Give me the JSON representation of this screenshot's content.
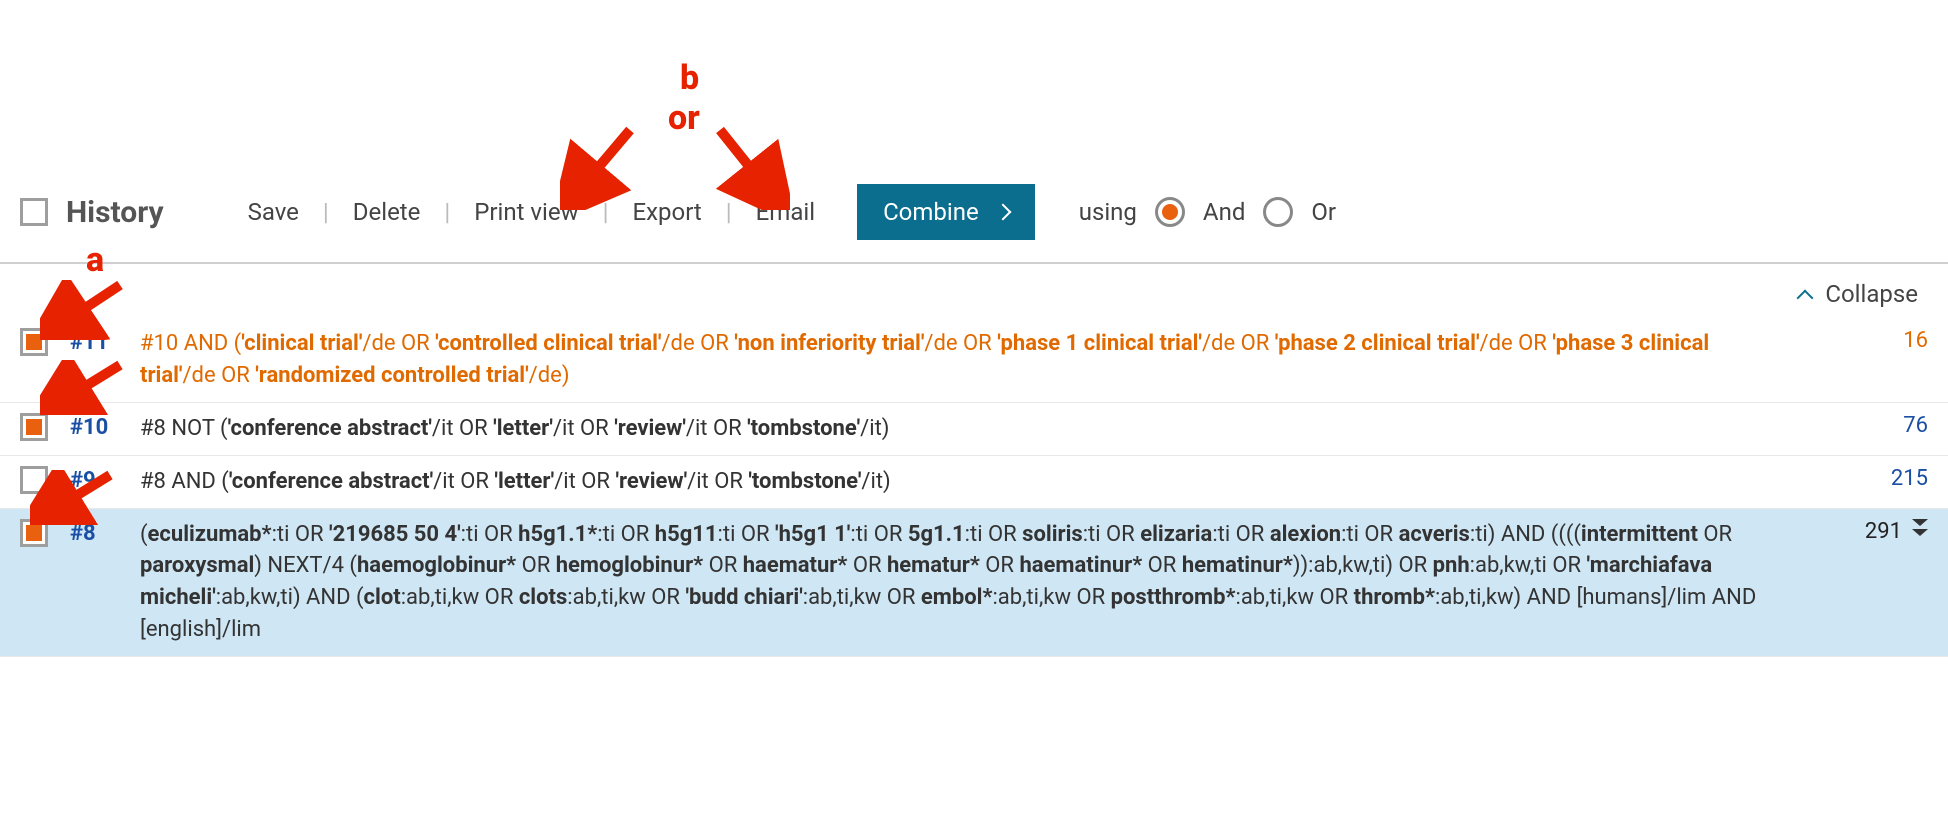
{
  "header": {
    "title": "History",
    "actions": {
      "save": "Save",
      "delete": "Delete",
      "print_view": "Print view",
      "export": "Export",
      "email": "Email"
    },
    "combine_label": "Combine",
    "using_label": "using",
    "and_label": "And",
    "or_label": "Or",
    "collapse_label": "Collapse"
  },
  "annotations": {
    "a": "a",
    "b": "b",
    "or": "or"
  },
  "rows": [
    {
      "id": "#11",
      "checked": true,
      "orange": true,
      "highlight": false,
      "count": "16",
      "count_style": "orange",
      "segments": [
        {
          "t": "#10 AND (",
          "b": false
        },
        {
          "t": "'clinical trial'",
          "b": true
        },
        {
          "t": "/de OR ",
          "b": false
        },
        {
          "t": "'controlled clinical trial'",
          "b": true
        },
        {
          "t": "/de OR ",
          "b": false
        },
        {
          "t": "'non inferiority trial'",
          "b": true
        },
        {
          "t": "/de OR ",
          "b": false
        },
        {
          "t": "'phase 1 clinical trial'",
          "b": true
        },
        {
          "t": "/de OR ",
          "b": false
        },
        {
          "t": "'phase 2 clinical trial'",
          "b": true
        },
        {
          "t": "/de OR ",
          "b": false
        },
        {
          "t": "'phase 3 clinical trial'",
          "b": true
        },
        {
          "t": "/de OR ",
          "b": false
        },
        {
          "t": "'randomized controlled trial'",
          "b": true
        },
        {
          "t": "/de)",
          "b": false
        }
      ]
    },
    {
      "id": "#10",
      "checked": true,
      "orange": false,
      "highlight": false,
      "count": "76",
      "count_style": "link",
      "segments": [
        {
          "t": "#8 NOT (",
          "b": false
        },
        {
          "t": "'conference abstract'",
          "b": true
        },
        {
          "t": "/it OR ",
          "b": false
        },
        {
          "t": "'letter'",
          "b": true
        },
        {
          "t": "/it OR ",
          "b": false
        },
        {
          "t": "'review'",
          "b": true
        },
        {
          "t": "/it OR ",
          "b": false
        },
        {
          "t": "'tombstone'",
          "b": true
        },
        {
          "t": "/it)",
          "b": false
        }
      ]
    },
    {
      "id": "#9",
      "checked": false,
      "orange": false,
      "highlight": false,
      "count": "215",
      "count_style": "link",
      "segments": [
        {
          "t": "#8 AND (",
          "b": false
        },
        {
          "t": "'conference abstract'",
          "b": true
        },
        {
          "t": "/it OR ",
          "b": false
        },
        {
          "t": "'letter'",
          "b": true
        },
        {
          "t": "/it OR ",
          "b": false
        },
        {
          "t": "'review'",
          "b": true
        },
        {
          "t": "/it OR ",
          "b": false
        },
        {
          "t": "'tombstone'",
          "b": true
        },
        {
          "t": "/it)",
          "b": false
        }
      ]
    },
    {
      "id": "#8",
      "checked": true,
      "orange": false,
      "highlight": true,
      "count": "291",
      "count_style": "black",
      "expand": true,
      "segments": [
        {
          "t": "(",
          "b": false
        },
        {
          "t": "eculizumab*",
          "b": true
        },
        {
          "t": ":ti OR ",
          "b": false
        },
        {
          "t": "'219685 50 4'",
          "b": true
        },
        {
          "t": ":ti OR ",
          "b": false
        },
        {
          "t": "h5g1.1*",
          "b": true
        },
        {
          "t": ":ti OR ",
          "b": false
        },
        {
          "t": "h5g11",
          "b": true
        },
        {
          "t": ":ti OR ",
          "b": false
        },
        {
          "t": "'h5g1 1'",
          "b": true
        },
        {
          "t": ":ti OR ",
          "b": false
        },
        {
          "t": "5g1.1",
          "b": true
        },
        {
          "t": ":ti OR ",
          "b": false
        },
        {
          "t": "soliris",
          "b": true
        },
        {
          "t": ":ti OR ",
          "b": false
        },
        {
          "t": "elizaria",
          "b": true
        },
        {
          "t": ":ti OR ",
          "b": false
        },
        {
          "t": "alexion",
          "b": true
        },
        {
          "t": ":ti OR ",
          "b": false
        },
        {
          "t": "acveris",
          "b": true
        },
        {
          "t": ":ti) AND ((((",
          "b": false
        },
        {
          "t": "intermittent",
          "b": true
        },
        {
          "t": " OR ",
          "b": false
        },
        {
          "t": "paroxysmal",
          "b": true
        },
        {
          "t": ") NEXT/4 (",
          "b": false
        },
        {
          "t": "haemoglobinur*",
          "b": true
        },
        {
          "t": " OR ",
          "b": false
        },
        {
          "t": "hemoglobinur*",
          "b": true
        },
        {
          "t": " OR ",
          "b": false
        },
        {
          "t": "haematur*",
          "b": true
        },
        {
          "t": " OR ",
          "b": false
        },
        {
          "t": "hematur*",
          "b": true
        },
        {
          "t": " OR ",
          "b": false
        },
        {
          "t": "haematinur*",
          "b": true
        },
        {
          "t": " OR ",
          "b": false
        },
        {
          "t": "hematinur*",
          "b": true
        },
        {
          "t": ")):ab,kw,ti) OR ",
          "b": false
        },
        {
          "t": "pnh",
          "b": true
        },
        {
          "t": ":ab,kw,ti OR ",
          "b": false
        },
        {
          "t": "'marchiafava micheli'",
          "b": true
        },
        {
          "t": ":ab,kw,ti) AND (",
          "b": false
        },
        {
          "t": "clot",
          "b": true
        },
        {
          "t": ":ab,ti,kw OR ",
          "b": false
        },
        {
          "t": "clots",
          "b": true
        },
        {
          "t": ":ab,ti,kw OR ",
          "b": false
        },
        {
          "t": "'budd chiari'",
          "b": true
        },
        {
          "t": ":ab,ti,kw OR ",
          "b": false
        },
        {
          "t": "embol*",
          "b": true
        },
        {
          "t": ":ab,ti,kw OR ",
          "b": false
        },
        {
          "t": "postthromb*",
          "b": true
        },
        {
          "t": ":ab,ti,kw OR ",
          "b": false
        },
        {
          "t": "thromb*",
          "b": true
        },
        {
          "t": ":ab,ti,kw) AND [humans]/lim AND [english]/lim",
          "b": false
        }
      ]
    }
  ]
}
